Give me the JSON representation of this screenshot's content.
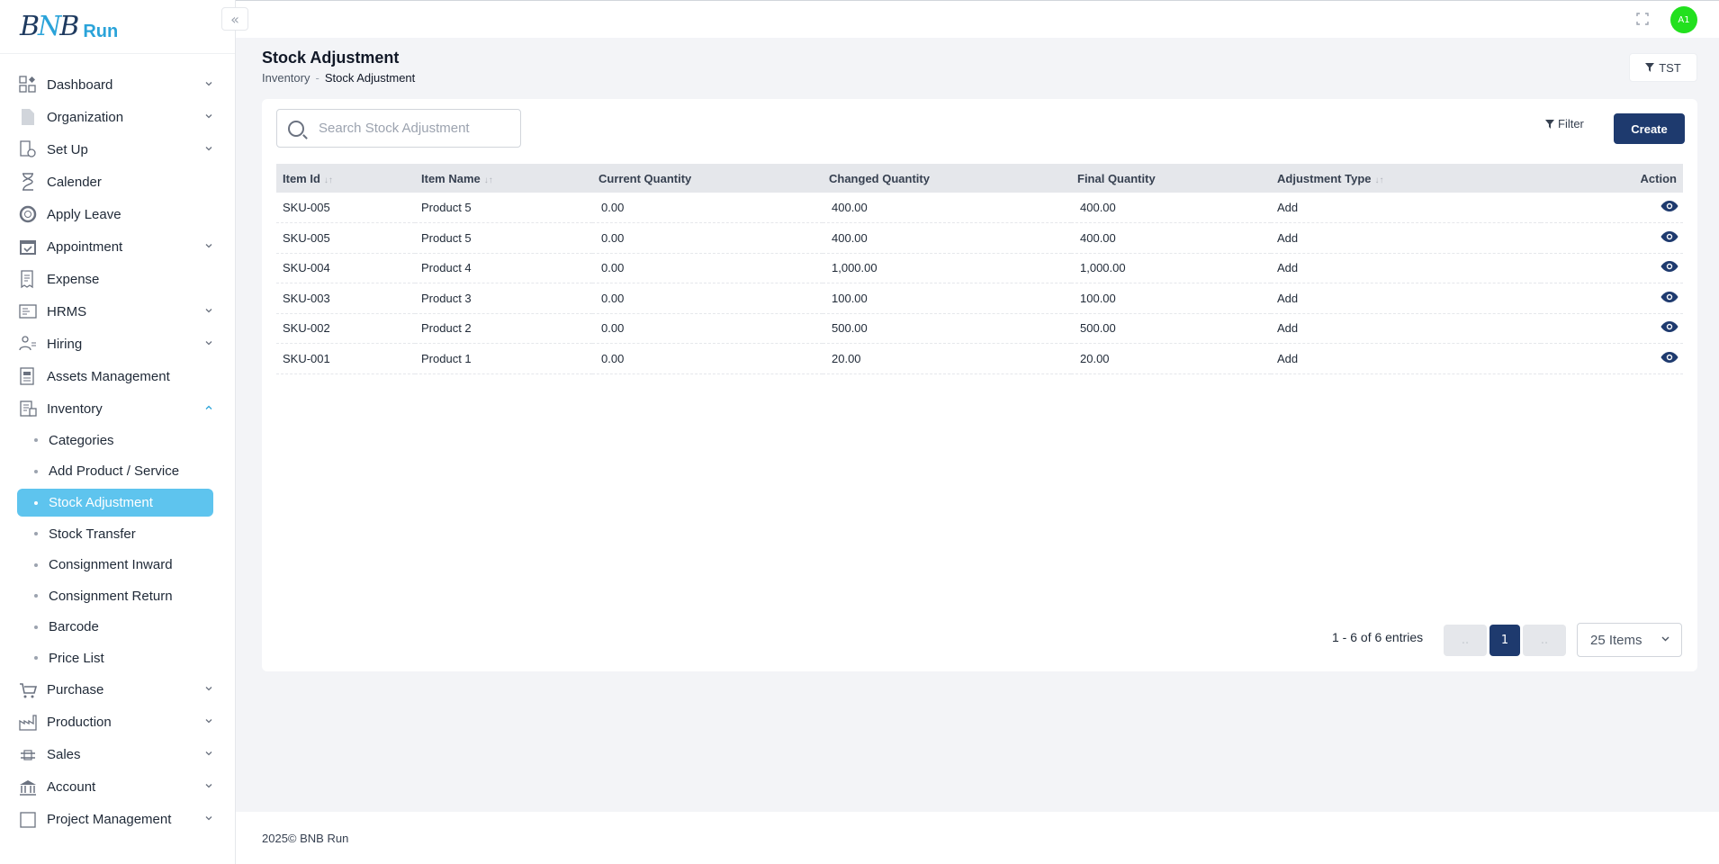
{
  "brand": {
    "logo_letters": "BNB",
    "logo_text": "Run"
  },
  "sidebar": {
    "items": [
      {
        "label": "Dashboard",
        "icon": "dashboard-icon",
        "chevron": true
      },
      {
        "label": "Organization",
        "icon": "document-icon",
        "chevron": true
      },
      {
        "label": "Set Up",
        "icon": "settings-doc-icon",
        "chevron": true
      },
      {
        "label": "Calender",
        "icon": "hourglass-icon",
        "chevron": false
      },
      {
        "label": "Apply Leave",
        "icon": "lifebuoy-icon",
        "chevron": false
      },
      {
        "label": "Appointment",
        "icon": "calendar-check-icon",
        "chevron": true
      },
      {
        "label": "Expense",
        "icon": "receipt-icon",
        "chevron": false
      },
      {
        "label": "HRMS",
        "icon": "id-card-icon",
        "chevron": true
      },
      {
        "label": "Hiring",
        "icon": "hiring-icon",
        "chevron": true
      },
      {
        "label": "Assets Management",
        "icon": "assets-icon",
        "chevron": false
      },
      {
        "label": "Inventory",
        "icon": "inventory-icon",
        "chevron": true
      }
    ],
    "inventory_sub": [
      {
        "label": "Categories"
      },
      {
        "label": "Add Product / Service"
      },
      {
        "label": "Stock Adjustment"
      },
      {
        "label": "Stock Transfer"
      },
      {
        "label": "Consignment Inward"
      },
      {
        "label": "Consignment Return"
      },
      {
        "label": "Barcode"
      },
      {
        "label": "Price List"
      }
    ],
    "items_after": [
      {
        "label": "Purchase",
        "icon": "cart-icon"
      },
      {
        "label": "Production",
        "icon": "factory-icon"
      },
      {
        "label": "Sales",
        "icon": "sales-icon"
      },
      {
        "label": "Account",
        "icon": "bank-icon"
      },
      {
        "label": "Project Management",
        "icon": "project-icon"
      }
    ]
  },
  "topbar": {
    "avatar_initials": "A1"
  },
  "header": {
    "title": "Stock Adjustment",
    "breadcrumb_parent": "Inventory",
    "breadcrumb_sep": "-",
    "breadcrumb_current": "Stock Adjustment",
    "tst_label": "TST"
  },
  "toolbar": {
    "search_placeholder": "Search Stock Adjustment",
    "filter_label": "Filter",
    "create_label": "Create"
  },
  "table": {
    "columns": [
      "Item Id",
      "Item Name",
      "Current Quantity",
      "Changed Quantity",
      "Final Quantity",
      "Adjustment Type",
      "Action"
    ],
    "rows": [
      {
        "item_id": "SKU-005",
        "item_name": "Product 5",
        "current": "0.00",
        "changed": "400.00",
        "final": "400.00",
        "type": "Add"
      },
      {
        "item_id": "SKU-005",
        "item_name": "Product 5",
        "current": "0.00",
        "changed": "400.00",
        "final": "400.00",
        "type": "Add"
      },
      {
        "item_id": "SKU-004",
        "item_name": "Product 4",
        "current": "0.00",
        "changed": "1,000.00",
        "final": "1,000.00",
        "type": "Add"
      },
      {
        "item_id": "SKU-003",
        "item_name": "Product 3",
        "current": "0.00",
        "changed": "100.00",
        "final": "100.00",
        "type": "Add"
      },
      {
        "item_id": "SKU-002",
        "item_name": "Product 2",
        "current": "0.00",
        "changed": "500.00",
        "final": "500.00",
        "type": "Add"
      },
      {
        "item_id": "SKU-001",
        "item_name": "Product 1",
        "current": "0.00",
        "changed": "20.00",
        "final": "20.00",
        "type": "Add"
      }
    ]
  },
  "pagination": {
    "entries_text": "1 - 6 of 6 entries",
    "prev": "..",
    "current_page": "1",
    "next": "..",
    "per_page": "25 Items"
  },
  "footer": {
    "text": "2025© BNB Run"
  },
  "colors": {
    "primary": "#1e3a6e",
    "active_nav": "#5ec4ee",
    "avatar": "#22e01e"
  }
}
